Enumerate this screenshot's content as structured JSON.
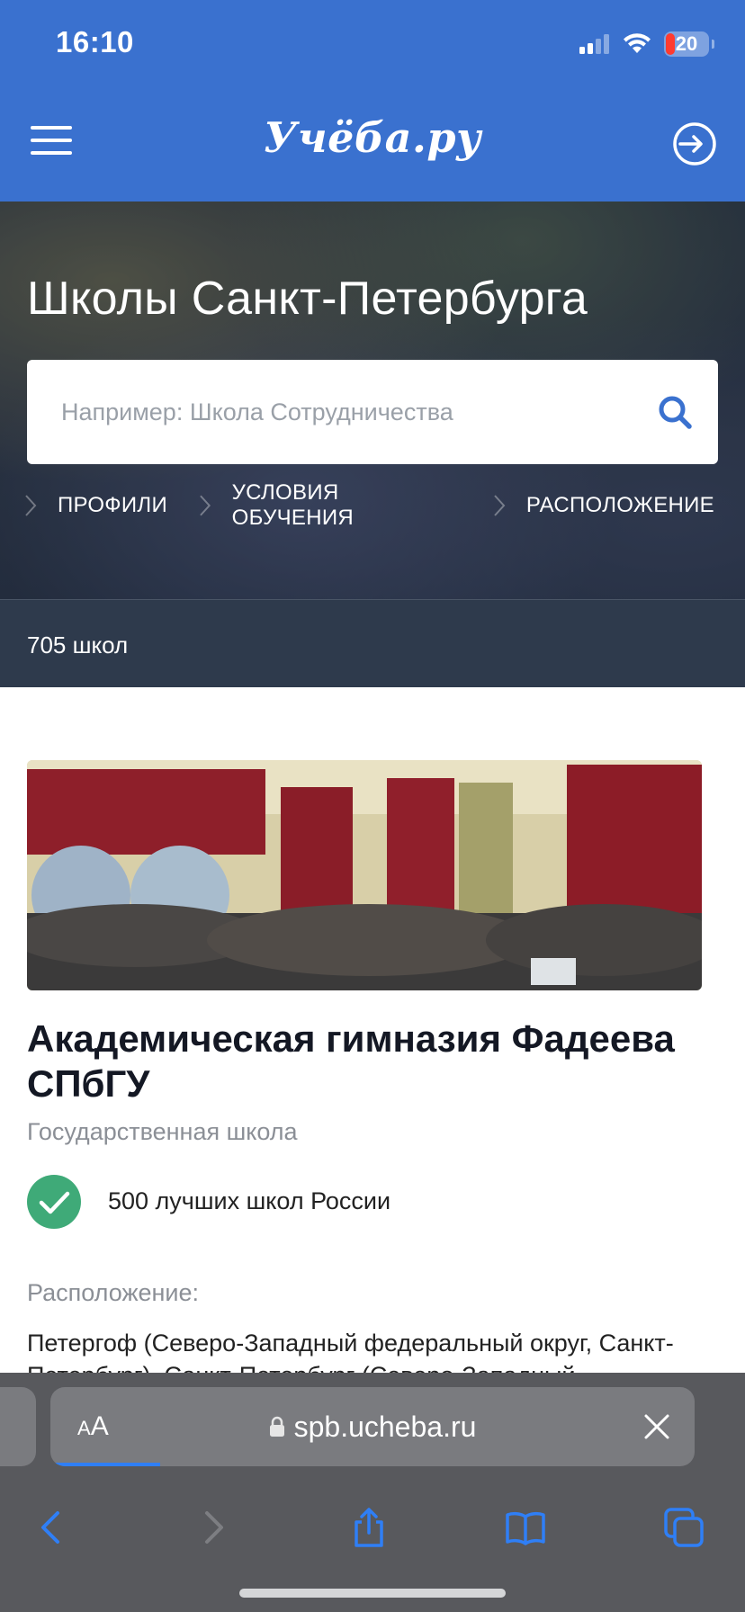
{
  "status_bar": {
    "time": "16:10",
    "battery": "20",
    "icons": [
      "signal-icon",
      "wifi-icon",
      "battery-icon"
    ]
  },
  "header": {
    "logo": "Учёба.ру",
    "icons": [
      "menu-icon",
      "login-icon"
    ]
  },
  "hero": {
    "title": "Школы Санкт-Петербурга",
    "search_placeholder": "Например: Школа Сотрудничества",
    "filters": [
      {
        "label": "ПРОФИЛИ"
      },
      {
        "label": "УСЛОВИЯ ОБУЧЕНИЯ"
      },
      {
        "label": "РАСПОЛОЖЕНИЕ"
      }
    ]
  },
  "results": {
    "count": "705 школ"
  },
  "school": {
    "name": "Академическая гимназия Фадеева СПбГУ",
    "type": "Государственная школа",
    "badge": "500 лучших школ России",
    "location_label": "Расположение:",
    "location_value": "Петергоф (Северо-Западный федеральный округ, Санкт-Петербург), Санкт-Петербург (Северо-Западный"
  },
  "browser": {
    "reader_small": "A",
    "reader_large": "A",
    "url": "spb.ucheba.ru",
    "load_progress": 0.17,
    "toolbar_icons": [
      "back-icon",
      "forward-icon",
      "share-icon",
      "bookmarks-icon",
      "tabs-icon"
    ]
  },
  "colors": {
    "header_blue": "#3a71cf",
    "badge_green": "#3faa78",
    "search_icon_blue": "#3a71cf",
    "browser_accent": "#2f7ff6"
  }
}
